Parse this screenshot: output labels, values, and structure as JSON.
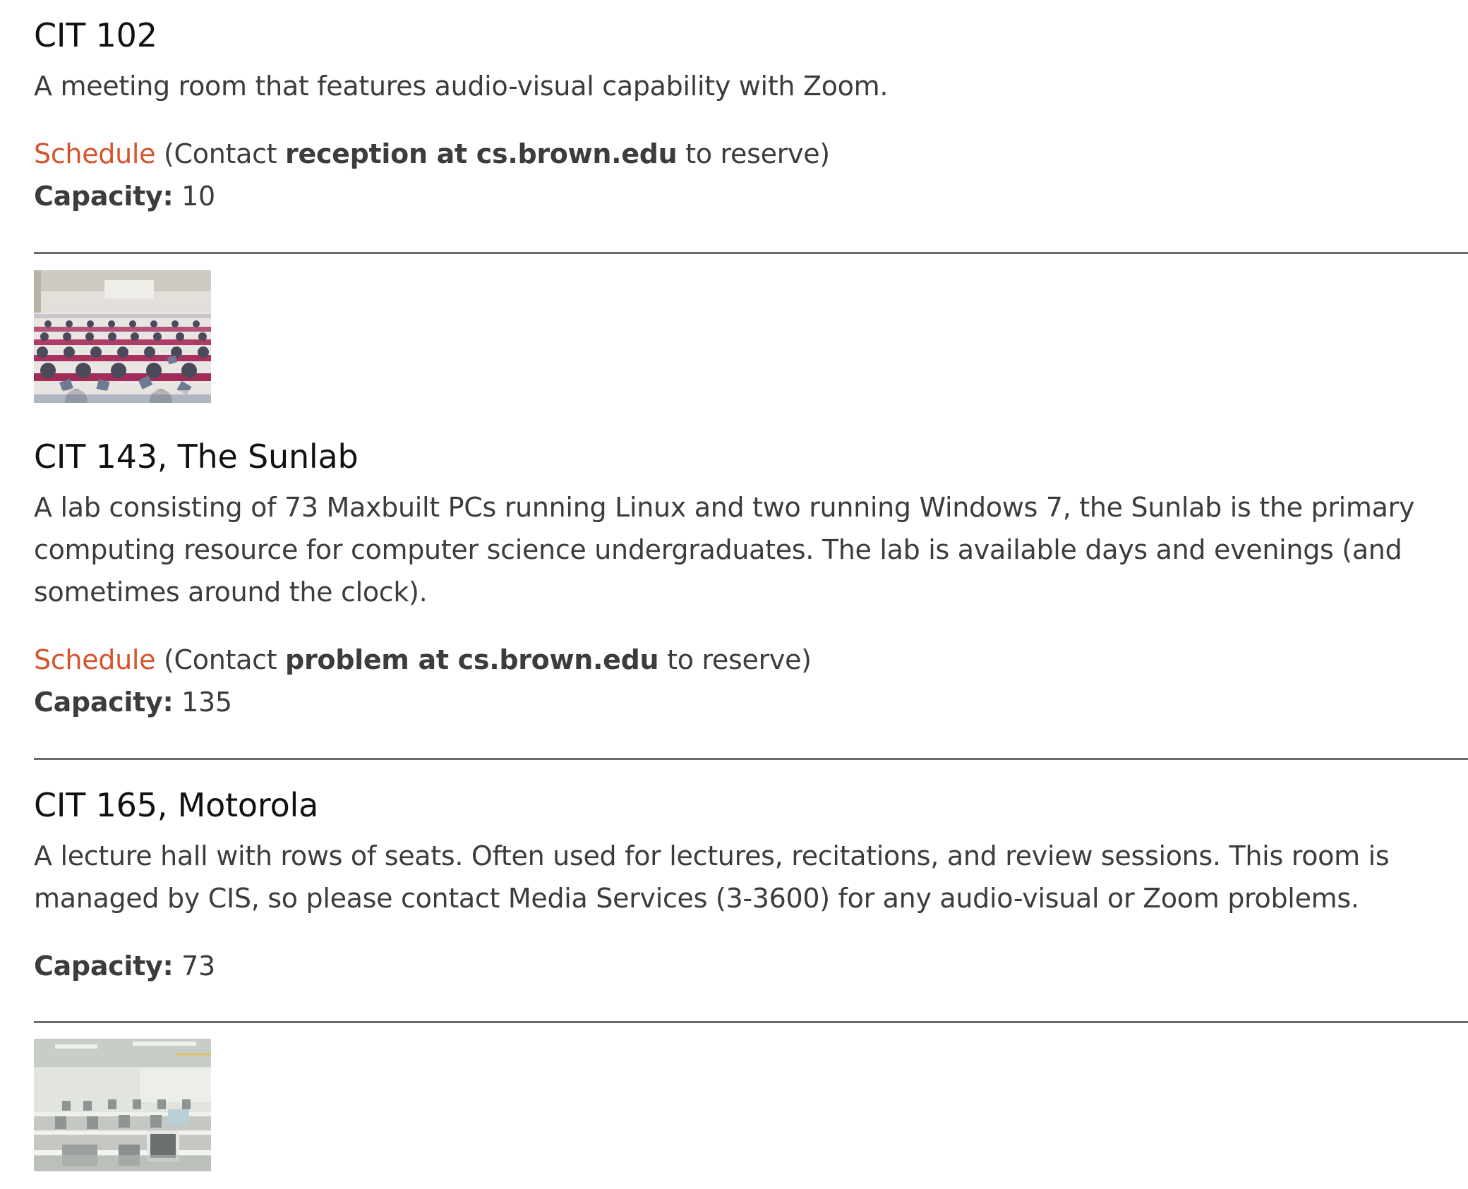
{
  "rooms": [
    {
      "title": "CIT 102",
      "description": "A meeting room that features audio-visual capability with Zoom.",
      "schedule_label": "Schedule",
      "contact_prefix": " (Contact ",
      "contact_email": "reception at cs.brown.edu",
      "contact_suffix": " to reserve)",
      "capacity_label": "Capacity:",
      "capacity_value": " 10"
    },
    {
      "title": "CIT 143, The Sunlab",
      "description": "A lab consisting of 73 Maxbuilt PCs running Linux and two running Windows 7, the Sunlab is the primary computing resource for computer science undergraduates. The lab is available days and evenings (and sometimes around the clock).",
      "schedule_label": "Schedule",
      "contact_prefix": " (Contact ",
      "contact_email": "problem at cs.brown.edu",
      "contact_suffix": " to reserve)",
      "capacity_label": "Capacity:",
      "capacity_value": " 135"
    },
    {
      "title": "CIT 165, Motorola",
      "description": "A lecture hall with rows of seats. Often used for lectures, recitations, and review sessions. This room is managed by CIS, so please contact Media Services (3-3600) for any audio-visual or Zoom problems.",
      "capacity_label": "Capacity:",
      "capacity_value": " 73"
    }
  ],
  "colors": {
    "link": "#d6532a",
    "text": "#3c3c3c",
    "heading": "#111111",
    "divider": "#6a6a6a"
  }
}
